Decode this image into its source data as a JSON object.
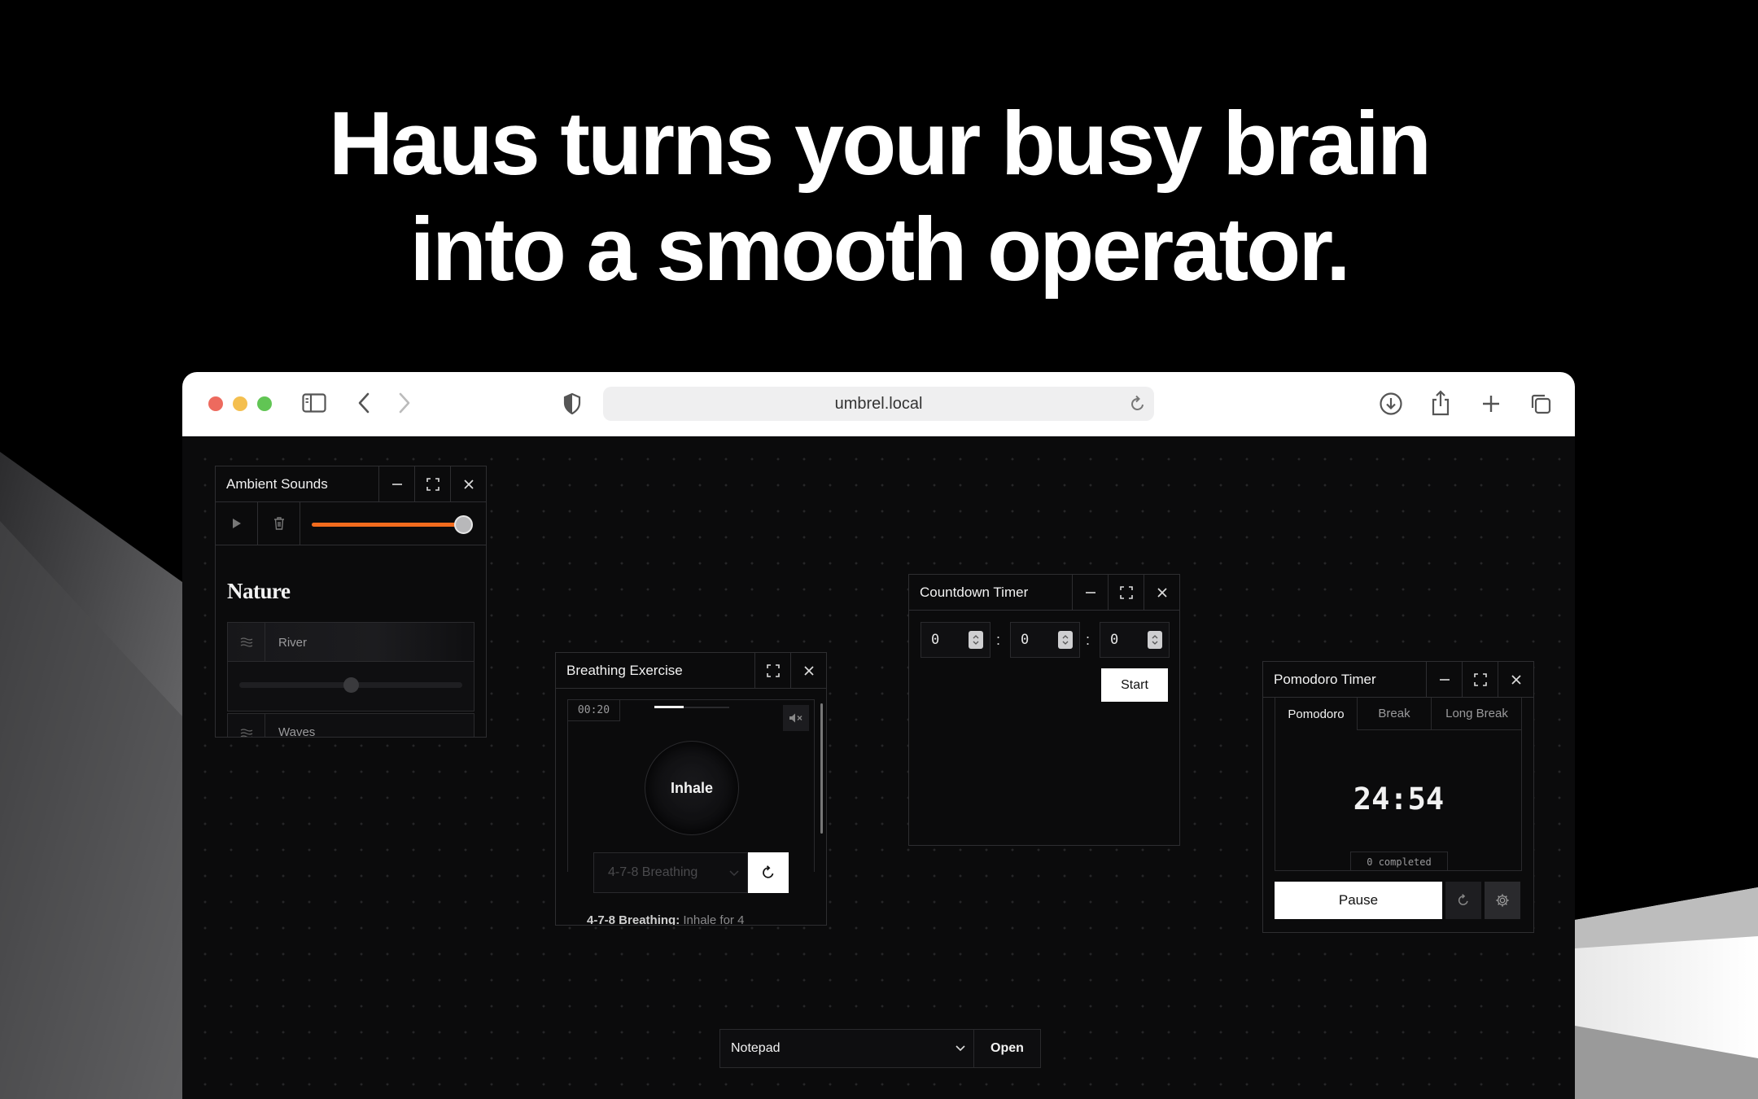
{
  "headline": {
    "line1": "Haus turns your busy brain",
    "line2": "into a smooth operator."
  },
  "browser": {
    "url": "umbrel.local",
    "colors": {
      "close": "#ed6a5e",
      "minimize": "#f4bf4f",
      "zoom": "#61c554"
    }
  },
  "ambient": {
    "title": "Ambient Sounds",
    "volume": 1.0,
    "accent": "#f26b1d",
    "section": "Nature",
    "sounds": [
      {
        "label": "River",
        "level": 0.5
      },
      {
        "label": "Waves"
      }
    ]
  },
  "breathing": {
    "title": "Breathing Exercise",
    "time": "00:20",
    "phase": "Inhale",
    "pattern": "4-7-8 Breathing",
    "desc_bold": "4-7-8 Breathing:",
    "desc": "Inhale for 4"
  },
  "countdown": {
    "title": "Countdown Timer",
    "hours": "0",
    "minutes": "0",
    "seconds": "0",
    "sep": ":",
    "start": "Start"
  },
  "pomodoro": {
    "title": "Pomodoro Timer",
    "tabs": [
      "Pomodoro",
      "Break",
      "Long Break"
    ],
    "time": "24:54",
    "completed": "0 completed",
    "pause": "Pause"
  },
  "launcher": {
    "selected": "Notepad",
    "open": "Open"
  }
}
